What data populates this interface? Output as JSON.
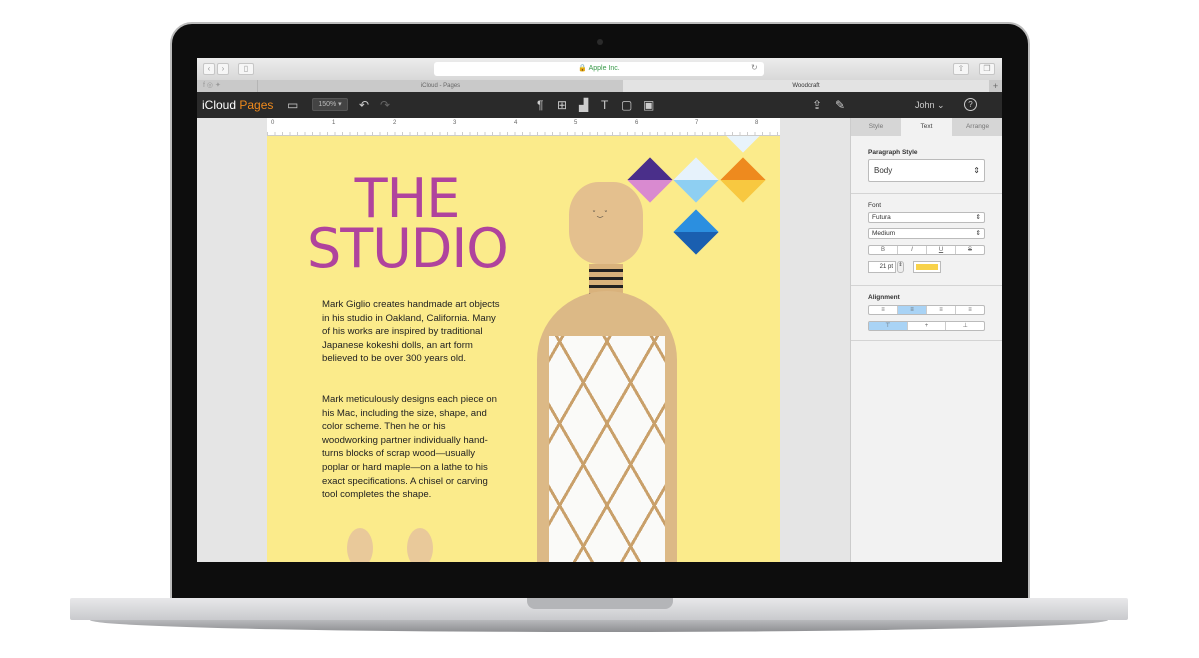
{
  "browser": {
    "url": "Apple Inc.",
    "tabs": [
      "iCloud - Pages",
      "Woodcraft"
    ],
    "new_tab": "+"
  },
  "app": {
    "brand_icloud": "iCloud",
    "brand_pages": "Pages",
    "zoom": "150% ▾",
    "user": "John ⌄",
    "help": "?"
  },
  "ruler": [
    "0",
    "1",
    "2",
    "3",
    "4",
    "5",
    "6",
    "7",
    "8"
  ],
  "document": {
    "title_line1": "THE",
    "title_line2": "STUDIO",
    "paragraph1": "Mark Giglio creates handmade art objects in his studio in Oakland, California. Many of his works are inspired by traditional Japanese kokeshi dolls, an art form believed to be over 300 years old.",
    "paragraph2": "Mark meticulously designs each piece on his Mac, including the size, shape, and color scheme. Then he or his woodworking partner individually hand-turns blocks of scrap wood—usually poplar or hard maple—on a lathe to his exact specifications. A chisel or carving tool completes the shape."
  },
  "panel": {
    "tabs": [
      "Style",
      "Text",
      "Arrange"
    ],
    "active_tab": "Text",
    "paragraph_style_label": "Paragraph Style",
    "paragraph_style": "Body",
    "font_label": "Font",
    "font": "Futura",
    "weight": "Medium",
    "styles": [
      "B",
      "I",
      "U",
      "S"
    ],
    "size": "21 pt",
    "color": "#f8d24a",
    "alignment_label": "Alignment",
    "align": [
      "≡",
      "≡",
      "≡",
      "≡"
    ],
    "valign": [
      "⊤",
      "+",
      "⊥"
    ]
  },
  "colors": {
    "accent": "#f08a1c",
    "title": "#b0439d",
    "page": "#fbeb8b"
  }
}
